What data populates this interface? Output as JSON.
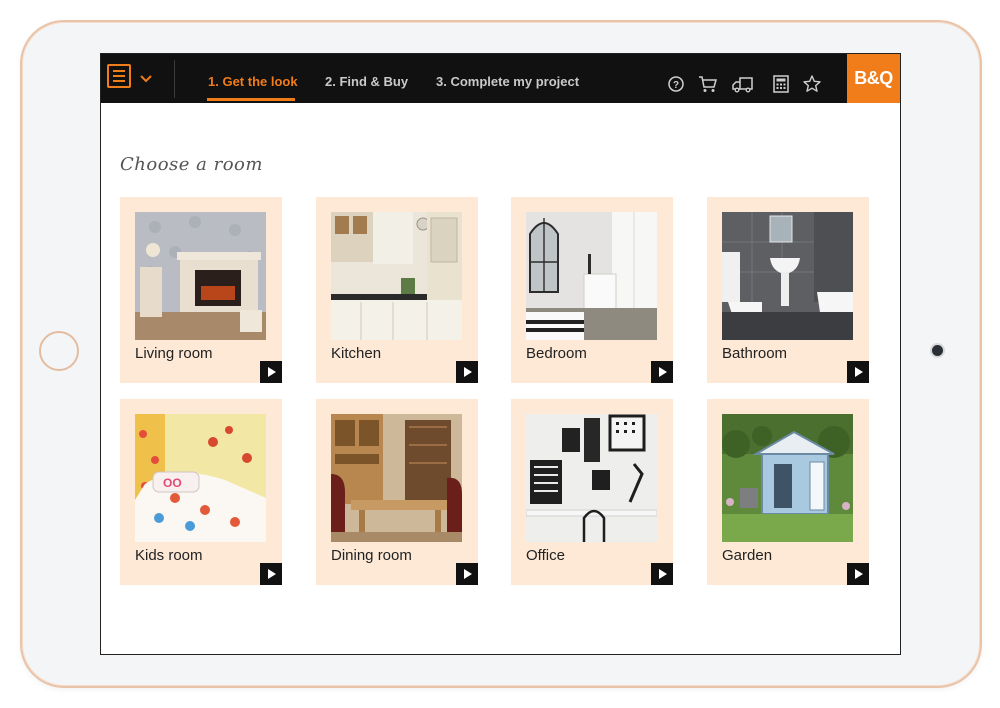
{
  "nav": {
    "tabs": [
      {
        "label": "1. Get the look",
        "active": true
      },
      {
        "label": "2. Find & Buy",
        "active": false
      },
      {
        "label": "3. Complete my project",
        "active": false
      }
    ],
    "icons": [
      "help-icon",
      "cart-icon",
      "delivery-truck-icon",
      "calculator-icon",
      "star-icon"
    ],
    "logo": "B&Q",
    "accent": "#f07c1a"
  },
  "main": {
    "heading": "Choose a room",
    "rooms": [
      {
        "label": "Living room"
      },
      {
        "label": "Kitchen"
      },
      {
        "label": "Bedroom"
      },
      {
        "label": "Bathroom"
      },
      {
        "label": "Kids room"
      },
      {
        "label": "Dining room"
      },
      {
        "label": "Office"
      },
      {
        "label": "Garden"
      }
    ],
    "card_color": "#fde9d6"
  }
}
